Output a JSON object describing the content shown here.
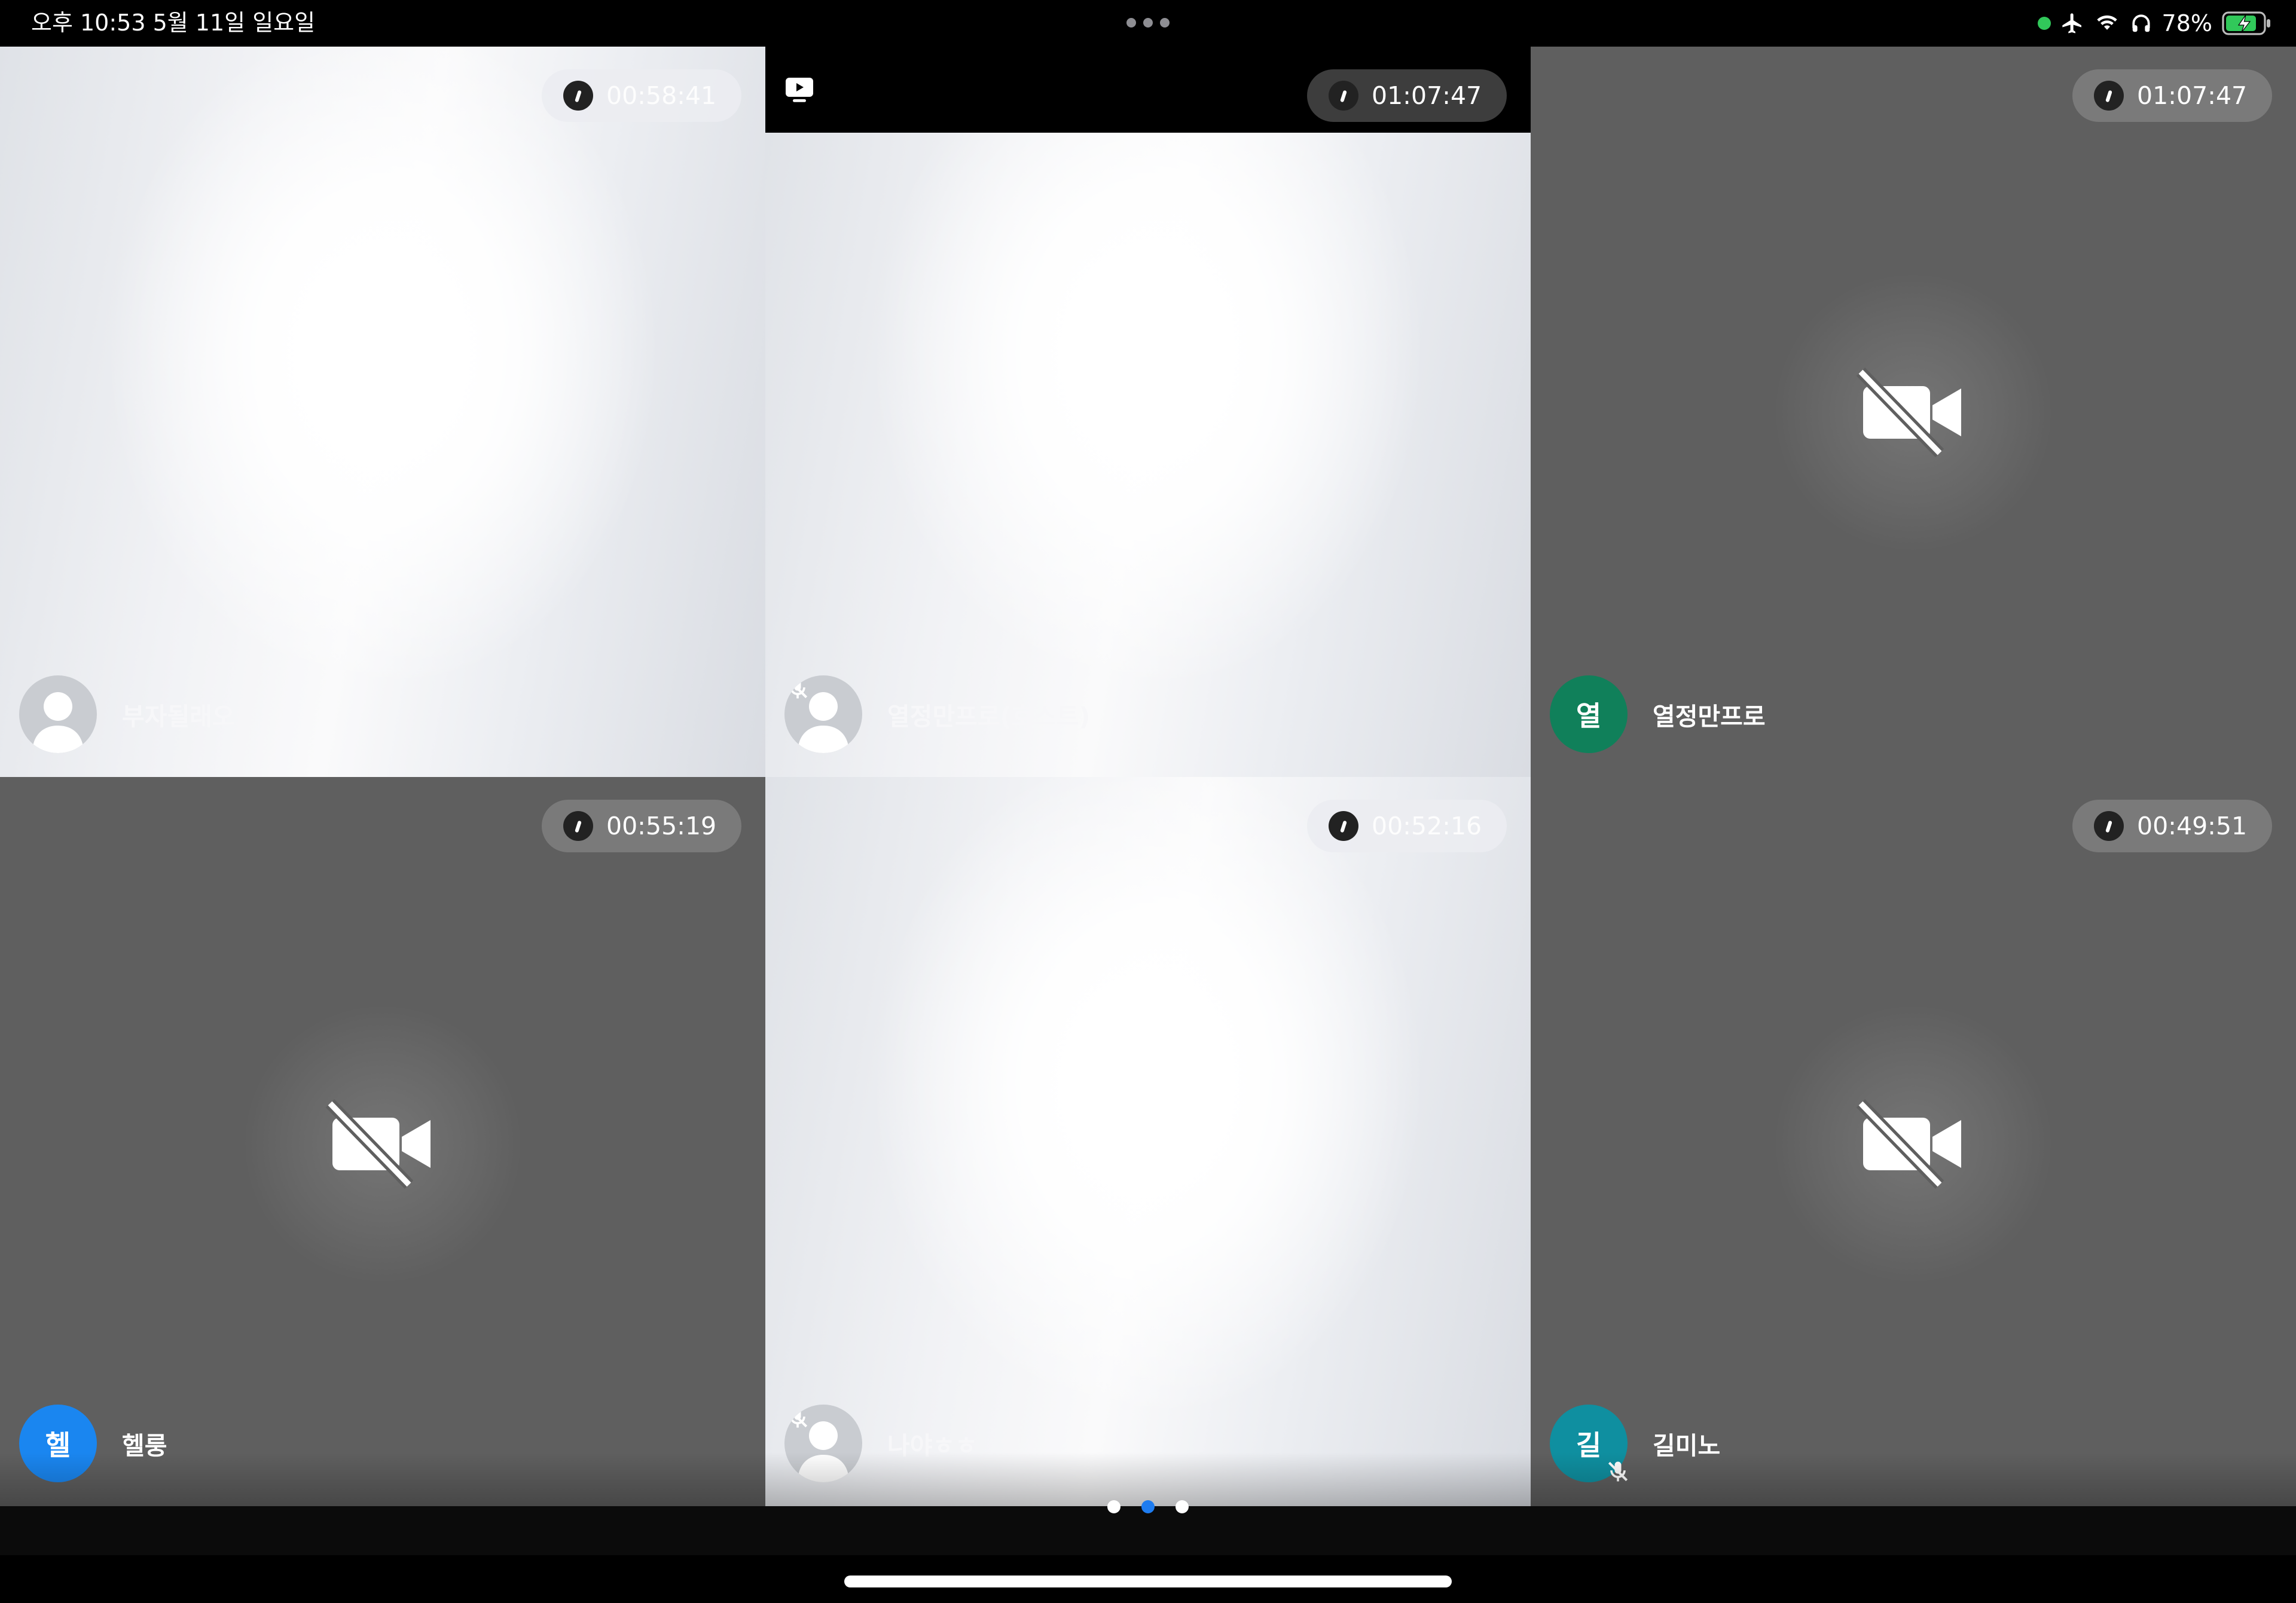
{
  "status_bar": {
    "time": "오후 10:53   5월 11일 일요일",
    "battery": "78%"
  },
  "tiles": [
    {
      "name": "부자될래오",
      "timer": "00:58:41",
      "style": "light",
      "avatar": "person",
      "muted": false
    },
    {
      "name": "열정만프로(호스트)",
      "timer": "01:07:47",
      "style": "light",
      "avatar": "person",
      "muted": true,
      "screen_share": true
    },
    {
      "name": "열정만프로",
      "timer": "01:07:47",
      "style": "dark",
      "avatar_initial": "열",
      "avatar_color": "#10805a",
      "muted": false,
      "camera_off": true
    },
    {
      "name": "헬룽",
      "timer": "00:55:19",
      "style": "dark",
      "avatar_initial": "헬",
      "avatar_color": "#1a86f0",
      "muted": false,
      "camera_off": true
    },
    {
      "name": "나야ㅎㅎ",
      "timer": "00:52:16",
      "style": "light",
      "avatar": "person",
      "muted": true
    },
    {
      "name": "길미노",
      "timer": "00:49:51",
      "style": "dark",
      "avatar_initial": "길",
      "avatar_color": "#0f8fa0",
      "muted": true,
      "camera_off": true
    }
  ],
  "pager": {
    "pages": 3,
    "active": 2
  },
  "colors": {
    "dark_tile": "#5f5f5f",
    "pager_active": "#1e7cf0"
  },
  "icons": {
    "camera_off": "video-camera-slash-icon",
    "mic_off": "microphone-slash-icon",
    "screen_share": "tv-play-icon",
    "timer": "clock-icon"
  }
}
